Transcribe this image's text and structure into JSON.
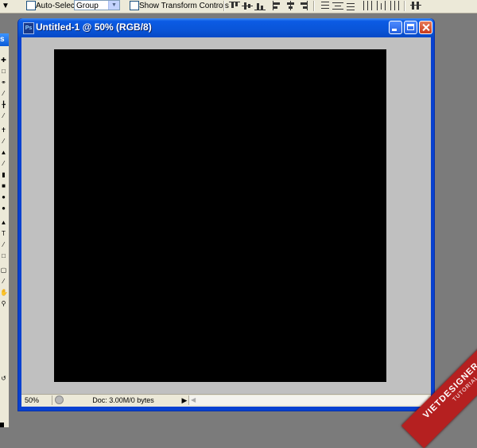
{
  "options_bar": {
    "auto_select_label": "Auto-Select:",
    "group_value": "Group",
    "transform_label": "Show Transform Controls"
  },
  "toolbox": {
    "header_fragment": "s",
    "tool_icons": [
      "move-icon",
      "marquee-icon",
      "lasso-icon",
      "magic-wand-icon",
      "crop-icon",
      "slice-icon",
      "healing-icon",
      "brush-icon",
      "stamp-icon",
      "history-brush-icon",
      "eraser-icon",
      "gradient-icon",
      "blur-icon",
      "dodge-icon",
      "path-select-icon",
      "type-icon",
      "pen-icon",
      "shape-icon",
      "notes-icon",
      "eyedropper-icon",
      "hand-icon",
      "zoom-icon"
    ]
  },
  "document": {
    "title": "Untitled-1 @ 50% (RGB/8)",
    "app_icon_text": "Ps",
    "canvas_color": "#000000",
    "zoom": "50%",
    "doc_info": "Doc: 3.00M/0 bytes"
  },
  "watermark": {
    "main": "VIETDESIGNER.NET",
    "sub": "TUTORIAL"
  }
}
